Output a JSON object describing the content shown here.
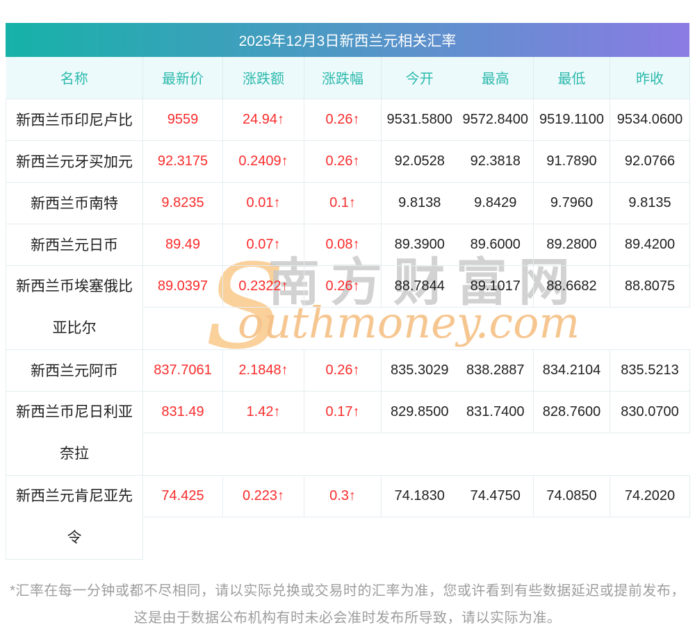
{
  "title_bar": "2025年12月3日新西兰元相关汇率",
  "table": {
    "headers": [
      "名称",
      "最新价",
      "涨跌额",
      "涨跌幅",
      "今开",
      "最高",
      "最低",
      "昨收"
    ],
    "rows": [
      {
        "name": "新西兰币印尼卢比",
        "name_lines": [
          "新西兰币印尼卢比"
        ],
        "latest": "9559",
        "change": "24.94↑",
        "pct": "0.26↑",
        "open": "9531.5800",
        "high": "9572.8400",
        "low": "9519.1100",
        "prev": "9534.0600"
      },
      {
        "name": "新西兰元牙买加元",
        "name_lines": [
          "新西兰元牙买加元"
        ],
        "latest": "92.3175",
        "change": "0.2409↑",
        "pct": "0.26↑",
        "open": "92.0528",
        "high": "92.3818",
        "low": "91.7890",
        "prev": "92.0766"
      },
      {
        "name": "新西兰币南特",
        "name_lines": [
          "新西兰币南特"
        ],
        "latest": "9.8235",
        "change": "0.01↑",
        "pct": "0.1↑",
        "open": "9.8138",
        "high": "9.8429",
        "low": "9.7960",
        "prev": "9.8135"
      },
      {
        "name": "新西兰元日币",
        "name_lines": [
          "新西兰元日币"
        ],
        "latest": "89.49",
        "change": "0.07↑",
        "pct": "0.08↑",
        "open": "89.3900",
        "high": "89.6000",
        "low": "89.2800",
        "prev": "89.4200"
      },
      {
        "name": "新西兰币埃塞俄比亚比尔",
        "name_lines": [
          "新西兰币埃塞俄比",
          "亚比尔"
        ],
        "latest": "89.0397",
        "change": "0.2322↑",
        "pct": "0.26↑",
        "open": "88.7844",
        "high": "89.1017",
        "low": "88.6682",
        "prev": "88.8075"
      },
      {
        "name": "新西兰元阿币",
        "name_lines": [
          "新西兰元阿币"
        ],
        "latest": "837.7061",
        "change": "2.1848↑",
        "pct": "0.26↑",
        "open": "835.3029",
        "high": "838.2887",
        "low": "834.2104",
        "prev": "835.5213"
      },
      {
        "name": "新西兰币尼日利亚奈拉",
        "name_lines": [
          "新西兰币尼日利亚",
          "奈拉"
        ],
        "latest": "831.49",
        "change": "1.42↑",
        "pct": "0.17↑",
        "open": "829.8500",
        "high": "831.7400",
        "low": "828.7600",
        "prev": "830.0700"
      },
      {
        "name": "新西兰元肯尼亚先令",
        "name_lines": [
          "新西兰元肯尼亚先",
          "令"
        ],
        "latest": "74.425",
        "change": "0.223↑",
        "pct": "0.3↑",
        "open": "74.1830",
        "high": "74.4750",
        "low": "74.0850",
        "prev": "74.2020"
      }
    ]
  },
  "watermark": {
    "initial": "S",
    "cn_text": "南方财富网",
    "en_text": "outhmoney.com"
  },
  "footnote": "*汇率在每一分钟或都不尽相同，请以实际兑换或交易时的汇率为准，您或许看到有些数据延迟或提前发布，这是由于数据公布机构有时未必会准时发布所导致，请以实际为准。",
  "colors": {
    "gradient_start": "#16b2a8",
    "gradient_end": "#8a7ce3",
    "header_bg": "#edfafb",
    "header_text": "#2bb9ac",
    "up_red": "#fa2b2b",
    "text_dark": "#1f1f1f",
    "border": "#e4edf0",
    "footnote_gray": "#9d9d9d",
    "watermark_orange": "#f6c086",
    "watermark_gray": "#c7c7c7"
  },
  "chart_data": {
    "type": "table",
    "title": "2025年12月3日新西兰元相关汇率",
    "columns": [
      "名称",
      "最新价",
      "涨跌额",
      "涨跌幅",
      "今开",
      "最高",
      "最低",
      "昨收"
    ],
    "rows": [
      [
        "新西兰币印尼卢比",
        "9559",
        "24.94↑",
        "0.26↑",
        "9531.5800",
        "9572.8400",
        "9519.1100",
        "9534.0600"
      ],
      [
        "新西兰元牙买加元",
        "92.3175",
        "0.2409↑",
        "0.26↑",
        "92.0528",
        "92.3818",
        "91.7890",
        "92.0766"
      ],
      [
        "新西兰币南特",
        "9.8235",
        "0.01↑",
        "0.1↑",
        "9.8138",
        "9.8429",
        "9.7960",
        "9.8135"
      ],
      [
        "新西兰元日币",
        "89.49",
        "0.07↑",
        "0.08↑",
        "89.3900",
        "89.6000",
        "89.2800",
        "89.4200"
      ],
      [
        "新西兰币埃塞俄比亚比尔",
        "89.0397",
        "0.2322↑",
        "0.26↑",
        "88.7844",
        "89.1017",
        "88.6682",
        "88.8075"
      ],
      [
        "新西兰元阿币",
        "837.7061",
        "2.1848↑",
        "0.26↑",
        "835.3029",
        "838.2887",
        "834.2104",
        "835.5213"
      ],
      [
        "新西兰币尼日利亚奈拉",
        "831.49",
        "1.42↑",
        "0.17↑",
        "829.8500",
        "831.7400",
        "828.7600",
        "830.0700"
      ],
      [
        "新西兰元肯尼亚先令",
        "74.425",
        "0.223↑",
        "0.3↑",
        "74.1830",
        "74.4750",
        "74.0850",
        "74.2020"
      ]
    ],
    "footnote": "*汇率在每一分钟或都不尽相同，请以实际兑换或交易时的汇率为准，您或许看到有些数据延迟或提前发布，这是由于数据公布机构有时未必会准时发布所导致，请以实际为准。"
  }
}
